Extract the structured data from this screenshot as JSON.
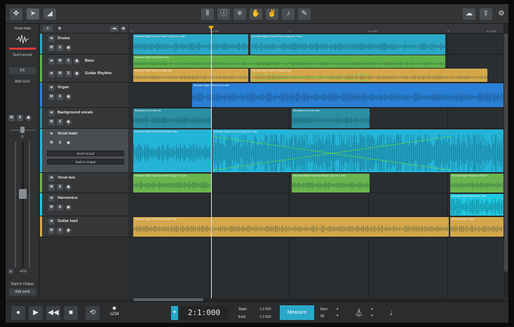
{
  "toolbar": {
    "left_icons": [
      "move-icon",
      "pointer-icon",
      "ramp-icon"
    ],
    "center_icons": [
      "mixer-icon",
      "info-icon",
      "scatter-icon",
      "hand-icon",
      "hand-edit-icon",
      "piano-icon",
      "pencil-icon"
    ],
    "right_icons": [
      "cloud-icon",
      "gear-icon"
    ]
  },
  "master": {
    "channel_label": "Vocal main",
    "dont_record": "Don't record",
    "fx_button": "FX",
    "add_fx": "ADD EFX",
    "mute": "M",
    "solo": "S",
    "pan_value": "0",
    "volume_value": "+0.0",
    "output_label": "Built-in Output",
    "add_send": "Add send"
  },
  "tracks": [
    {
      "name": "Drums",
      "color": "#2aa8c8"
    },
    {
      "name": "Bass",
      "name2": "Guitar Rhythm",
      "color": "#5fb24a"
    },
    {
      "name": "Organ",
      "color": "#2a7fd6"
    },
    {
      "name": "Background vocals",
      "color": "#2b8fa5"
    },
    {
      "name": "Vocal main",
      "color": "#24b4d8",
      "field1": "Don't record",
      "field2": "Built-in Output"
    },
    {
      "name": "Vocal aux",
      "color": "#6ab54f"
    },
    {
      "name": "Harmonica",
      "color": "#1ec8e0"
    },
    {
      "name": "Guitar lead",
      "color": "#d4a84a"
    }
  ],
  "track_buttons": {
    "mute": "M",
    "solo": "S"
  },
  "ruler": {
    "ticks": [
      "1",
      "2:1:000",
      "3",
      "4:1:000",
      "5",
      "6:1:000"
    ]
  },
  "clips": {
    "drums_a": "Karaoke Night Chorus Piano A (vip) ee 4.wav",
    "drums_b": "Karaoke Night Chorus Piano A (vip) ee 4.wav",
    "bass": "Karaoke Night Vocal Wide.wav",
    "guitar_a": "Karaoke Night Verse A Guitar.wav",
    "guitar_b": "Karaoke Night Verse A Rhythm.wav",
    "organ": "Karaoke Night Chorus Hi-A.wav",
    "bg_a": "Background-vocals.wav",
    "bg_b": "Background-vocals.wav",
    "vocal_a": "Karaoke Night Chorus Synthesize.wav",
    "vocal_b": "Karaoke Night Chorus A (vip) ee 1.wav",
    "aux_a": "Karaoke Night Vocal Aux Beat F (vip) ee 1.wav",
    "aux_b": "Karaoke Night Vocal Aux Beat F (vip) ee 1.wav",
    "aux_c": "Karaoke Night Vocal Aux Beat F",
    "harm": "Karaoke Night Harmonica Solo",
    "lead_a": "Karaoke Night Verse Fuzz Beat F Mix",
    "lead_b": "Karaoke Night Verse"
  },
  "transport": {
    "time": "2:1:000",
    "start_label": "Start",
    "end_label": "End",
    "start_value": "1:1:000",
    "end_value": "1:1:000",
    "measure_label": "Measure",
    "bpm_label": "Bpm",
    "bpm_value": "88",
    "loop_count": "1234",
    "colors": {
      "accent": "#2aa8c8",
      "playhead": "#f0b400"
    }
  }
}
